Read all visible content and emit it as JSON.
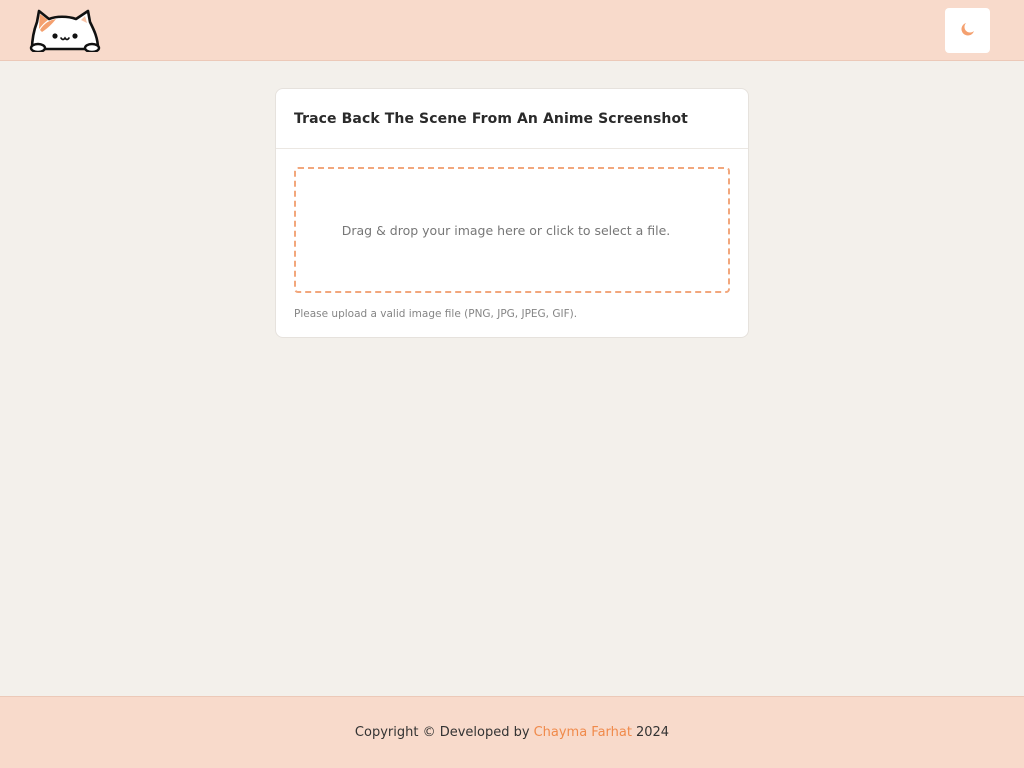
{
  "header": {
    "logo_icon": "cat-peeking-logo-icon",
    "theme_toggle_icon": "moon-icon",
    "accent_color": "#f4a06f"
  },
  "card": {
    "title": "Trace Back The Scene From An Anime Screenshot",
    "dropzone_text": "Drag & drop your image here or click to select a file.",
    "hint": "Please upload a valid image file (PNG, JPG, JPEG, GIF)."
  },
  "footer": {
    "prefix": "Copyright © Developed by",
    "author": "Chayma Farhat",
    "year": "2024"
  }
}
